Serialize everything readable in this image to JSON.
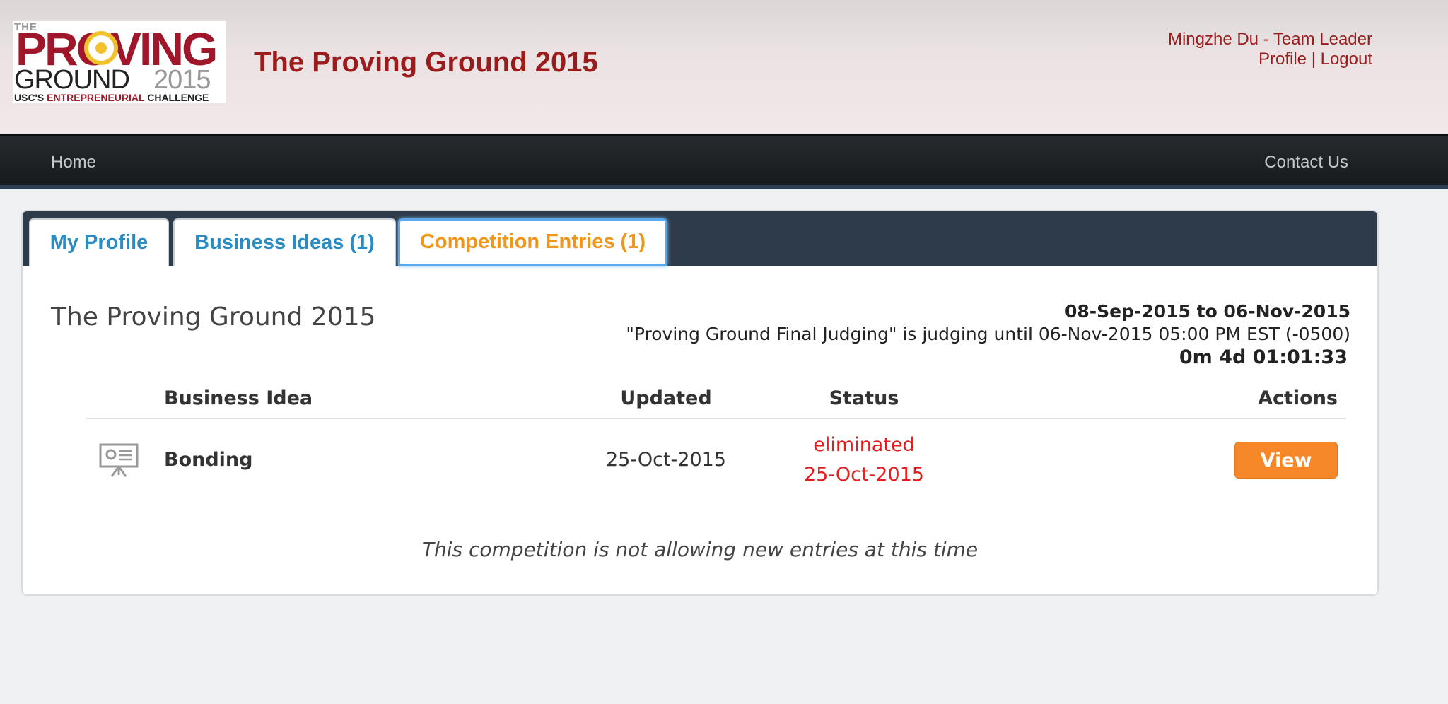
{
  "header": {
    "logo": {
      "the": "THE",
      "proving": "PROVING",
      "ground": "GROUND",
      "year": "2015",
      "tag_prefix": "USC'S",
      "tag_red": "ENTREPRENEURIAL",
      "tag_suffix": "CHALLENGE"
    },
    "title": "The Proving Ground 2015",
    "user": "Mingzhe Du - Team Leader",
    "profile_link": "Profile",
    "separator": "|",
    "logout_link": "Logout"
  },
  "nav": {
    "home": "Home",
    "contact": "Contact Us"
  },
  "tabs": [
    {
      "label": "My Profile"
    },
    {
      "label": "Business Ideas (1)"
    },
    {
      "label": "Competition Entries (1)"
    }
  ],
  "competition": {
    "title": "The Proving Ground 2015",
    "date_range": "08-Sep-2015 to 06-Nov-2015",
    "judging_note": "\"Proving Ground Final Judging\" is judging until 06-Nov-2015 05:00 PM EST (-0500)",
    "countdown": "0m 4d 01:01:33"
  },
  "table": {
    "headers": {
      "idea": "Business Idea",
      "updated": "Updated",
      "status": "Status",
      "actions": "Actions"
    },
    "rows": [
      {
        "idea": "Bonding",
        "updated": "25-Oct-2015",
        "status": "eliminated",
        "status_date": "25-Oct-2015",
        "action": "View",
        "icon": "presentation-icon"
      }
    ]
  },
  "notice": "This competition is not allowing new entries at this time",
  "colors": {
    "brand_red": "#9b1c1c",
    "tab_blue": "#2a8cc4",
    "tab_active": "#f0961a",
    "button": "#f7882a",
    "status_red": "#e61c1c"
  }
}
